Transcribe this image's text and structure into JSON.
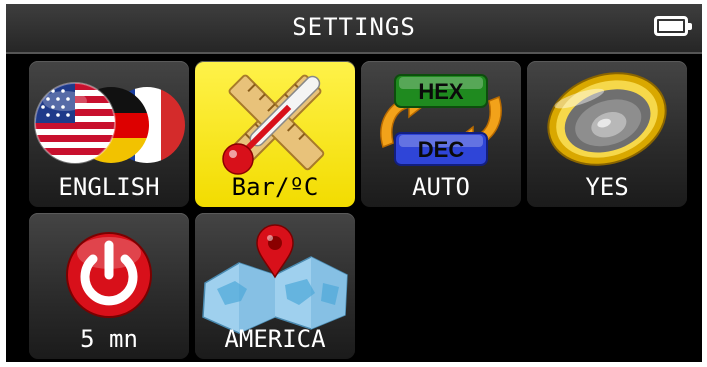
{
  "title": "SETTINGS",
  "battery": {
    "icon": "battery-full-icon"
  },
  "tiles": [
    {
      "label": "ENGLISH",
      "icon": "language-flags-icon",
      "selected": false
    },
    {
      "label": "Bar/ºC",
      "icon": "thermometer-ruler-icon",
      "selected": true
    },
    {
      "label": "AUTO",
      "icon": "hex-dec-toggle-icon",
      "selected": false
    },
    {
      "label": "YES",
      "icon": "speaker-icon",
      "selected": false
    },
    {
      "label": "5 mn",
      "icon": "power-icon",
      "selected": false
    },
    {
      "label": "AMERICA",
      "icon": "map-pin-icon",
      "selected": false
    }
  ],
  "hex_dec": {
    "top": "HEX",
    "bottom": "DEC"
  },
  "colors": {
    "selected_tile": "#f2dc00",
    "background": "#000000",
    "power_red": "#d8101a"
  }
}
